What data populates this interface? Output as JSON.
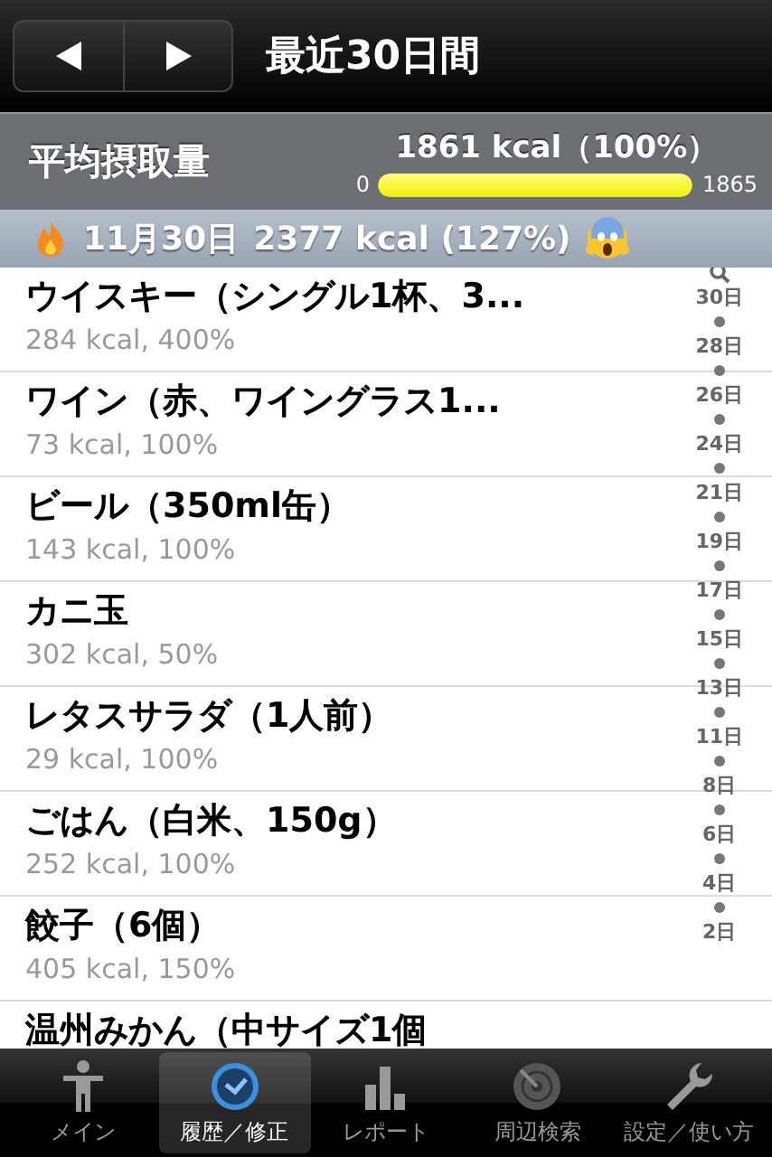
{
  "nav": {
    "title": "最近30日間"
  },
  "summary": {
    "label": "平均摂取量",
    "value": "1861 kcal（100%）",
    "min": "0",
    "max": "1865",
    "level": 0.998
  },
  "day": {
    "date": "11月30日",
    "total": "2377 kcal (127%)"
  },
  "items": [
    {
      "name": "ウイスキー（シングル1杯、3...",
      "detail": "284 kcal, 400%"
    },
    {
      "name": "ワイン（赤、ワイングラス1...",
      "detail": "73 kcal, 100%"
    },
    {
      "name": "ビール（350ml缶）",
      "detail": "143 kcal, 100%"
    },
    {
      "name": "カニ玉",
      "detail": "302 kcal, 50%"
    },
    {
      "name": "レタスサラダ（1人前）",
      "detail": "29 kcal, 100%"
    },
    {
      "name": "ごはん（白米、150g）",
      "detail": "252 kcal, 100%"
    },
    {
      "name": "餃子（6個）",
      "detail": "405 kcal, 150%"
    },
    {
      "name": "温州みかん（中サイズ1個"
    }
  ],
  "index": [
    "30日",
    "28日",
    "26日",
    "24日",
    "21日",
    "19日",
    "17日",
    "15日",
    "13日",
    "11日",
    "8日",
    "6日",
    "4日",
    "2日"
  ],
  "tabs": [
    {
      "label": "メイン",
      "selected": false
    },
    {
      "label": "履歴／修正",
      "selected": true
    },
    {
      "label": "レポート",
      "selected": false
    },
    {
      "label": "周辺検索",
      "selected": false
    },
    {
      "label": "設定／使い方",
      "selected": false
    }
  ]
}
